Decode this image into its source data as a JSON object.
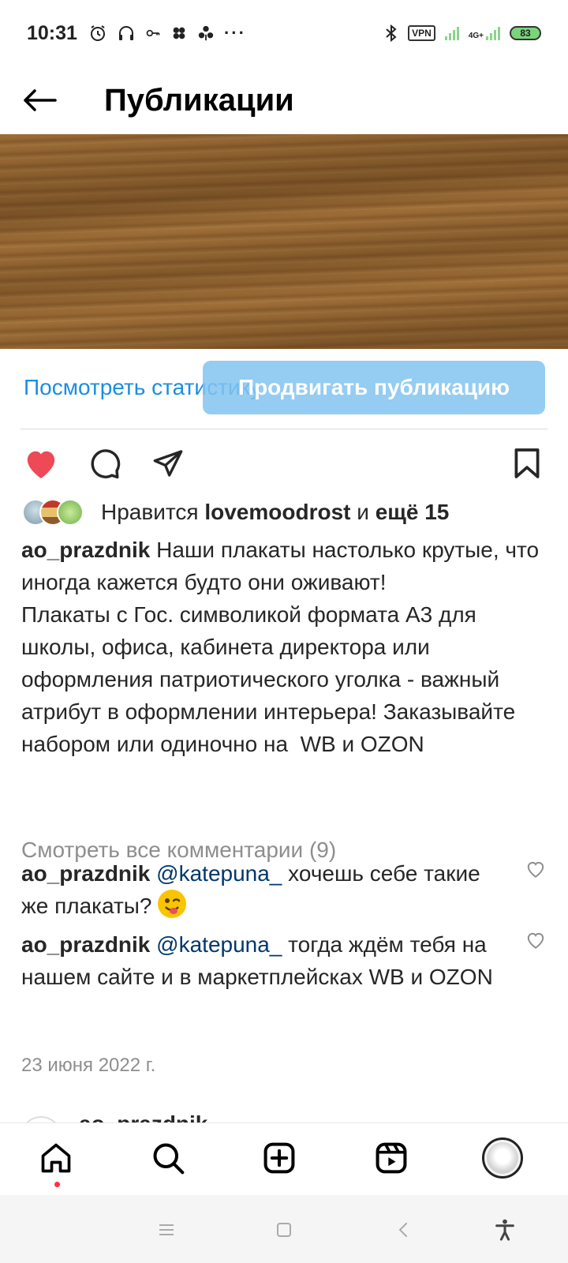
{
  "status_bar": {
    "time": "10:31",
    "vpn_label": "VPN",
    "network_label": "4G+",
    "battery": "83"
  },
  "header": {
    "title": "Публикации"
  },
  "post_actions": {
    "view_stats_label": "Посмотреть статистику",
    "promote_label": "Продвигать публикацию"
  },
  "likes": {
    "prefix": "Нравится ",
    "user": "lovemoodrost",
    "middle": " и ",
    "others": "ещё 15"
  },
  "caption": {
    "author": "ao_prazdnik",
    "text": " Наши плакаты настолько крутые, что иногда кажется будто они оживают!\nПлакаты с Гос. символикой формата А3 для школы, офиса, кабинета директора или оформления патриотического уголка - важный атрибут в оформлении интерьера! Заказывайте набором или одиночно на  WB и OZON"
  },
  "view_all_comments": "Смотреть все комментарии (9)",
  "comments": [
    {
      "author": "ao_prazdnik",
      "mention": "@katepuna_",
      "text": " хочешь себе такие же плакаты? "
    },
    {
      "author": "ao_prazdnik",
      "mention": "@katepuna_",
      "text": " тогда ждём тебя на нашем сайте и в маркетплейсках WB и OZON"
    }
  ],
  "post_date": "23 июня 2022 г.",
  "next_post": {
    "author": "ao_prazdnik"
  },
  "colors": {
    "like_red": "#ed4956",
    "link_blue": "#1a8ee0",
    "mention_blue": "#00376b",
    "muted_gray": "#8e8e8e"
  },
  "icons": {
    "back": "arrow-left-icon",
    "like": "heart-filled-icon",
    "comment": "speech-bubble-icon",
    "share": "paper-plane-icon",
    "save": "bookmark-icon",
    "nav": [
      "home-icon",
      "search-icon",
      "add-post-icon",
      "reels-icon",
      "profile-avatar"
    ]
  }
}
